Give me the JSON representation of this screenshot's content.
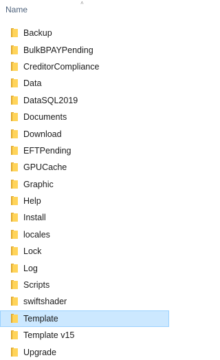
{
  "header": {
    "name_label": "Name",
    "sort_indicator": "˄"
  },
  "icons": {
    "folder": "folder-icon",
    "folder_color": "#ffd45a",
    "folder_shadow": "#e0a82a"
  },
  "selection_color": "#cce8ff",
  "items": [
    {
      "label": "Backup",
      "selected": false
    },
    {
      "label": "BulkBPAYPending",
      "selected": false
    },
    {
      "label": "CreditorCompliance",
      "selected": false
    },
    {
      "label": "Data",
      "selected": false
    },
    {
      "label": "DataSQL2019",
      "selected": false
    },
    {
      "label": "Documents",
      "selected": false
    },
    {
      "label": "Download",
      "selected": false
    },
    {
      "label": "EFTPending",
      "selected": false
    },
    {
      "label": "GPUCache",
      "selected": false
    },
    {
      "label": "Graphic",
      "selected": false
    },
    {
      "label": "Help",
      "selected": false
    },
    {
      "label": "Install",
      "selected": false
    },
    {
      "label": "locales",
      "selected": false
    },
    {
      "label": "Lock",
      "selected": false
    },
    {
      "label": "Log",
      "selected": false
    },
    {
      "label": "Scripts",
      "selected": false
    },
    {
      "label": "swiftshader",
      "selected": false
    },
    {
      "label": "Template",
      "selected": true
    },
    {
      "label": "Template v15",
      "selected": false
    },
    {
      "label": "Upgrade",
      "selected": false
    }
  ]
}
